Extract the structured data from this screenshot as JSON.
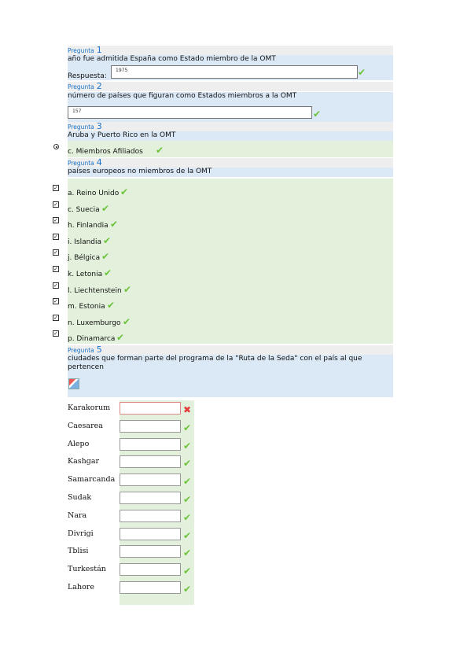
{
  "q1": {
    "label": "Pregunta",
    "num": "1",
    "text": "año fue admitida España como Estado miembro de la OMT",
    "answer_label": "Respuesta:",
    "value": "1975"
  },
  "q2": {
    "label": "Pregunta",
    "num": "2",
    "text": "número de países que figuran como Estados miembros a la OMT",
    "value": "157"
  },
  "q3": {
    "label": "Pregunta",
    "num": "3",
    "text": "Aruba y Puerto Rico en la OMT",
    "answer": "c. Miembros Afiliados"
  },
  "q4": {
    "label": "Pregunta",
    "num": "4",
    "text": "países europeos no miembros de la OMT",
    "options": [
      "a. Reino Unido",
      "c. Suecia",
      "h. Finlandia",
      "i. Islandia",
      "j. Bélgica",
      "k. Letonia",
      "l. Liechtenstein",
      "m. Estonia",
      "n. Luxemburgo",
      "p. Dinamarca"
    ]
  },
  "q5": {
    "label": "Pregunta",
    "num": "5",
    "text": "ciudades que forman parte del programa de la \"Ruta de la Seda\" con el país al que pertencen",
    "cities": [
      "Karakorum",
      "Caesarea",
      "Alepo",
      "Kashgar",
      "Samarcanda",
      "Sudak",
      "Nara",
      "Divrigi",
      "Tblisi",
      "Turkestán",
      "Lahore"
    ]
  },
  "marks": {
    "correct": "✔",
    "wrong": "✖"
  },
  "icons": {
    "check": "check-icon",
    "cross": "cross-icon",
    "image": "image-placeholder-icon"
  }
}
